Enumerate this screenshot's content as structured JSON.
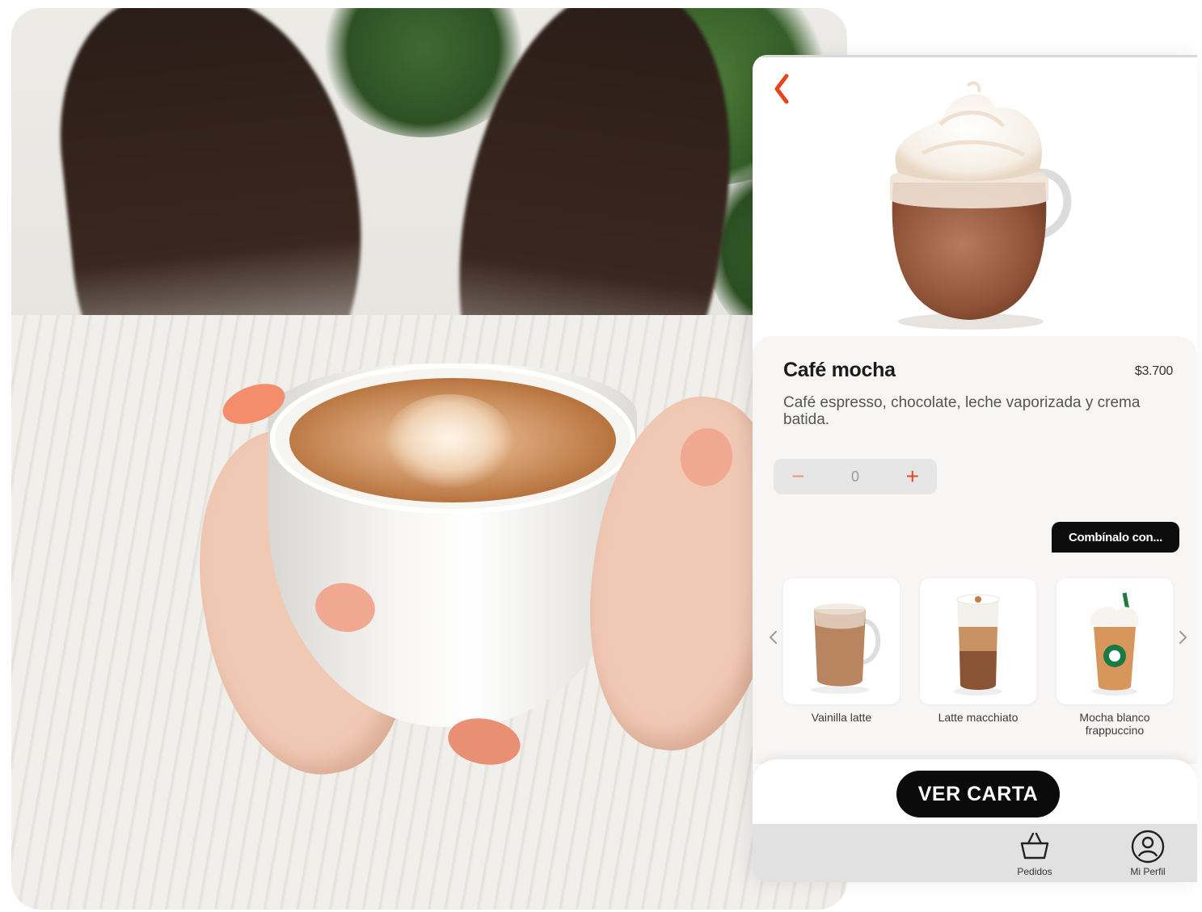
{
  "product": {
    "name": "Café mocha",
    "price": "$3.700",
    "description": "Café espresso, chocolate, leche vaporizada y crema batida."
  },
  "stepper": {
    "minus_label": "−",
    "quantity": "0",
    "plus_label": "+"
  },
  "combine": {
    "label": "Combínalo con..."
  },
  "suggestions": [
    {
      "name": "Vainilla latte"
    },
    {
      "name": "Latte macchiato"
    },
    {
      "name": "Mocha blanco frappuccino"
    }
  ],
  "cta": {
    "label": "VER CARTA"
  },
  "tabbar": {
    "items": [
      {
        "label": "Pedidos",
        "icon": "basket-icon"
      },
      {
        "label": "Mi Perfil",
        "icon": "profile-icon"
      }
    ]
  },
  "icons": {
    "back": "chevron-left-icon",
    "carousel_prev": "chevron-left-icon",
    "carousel_next": "chevron-right-icon"
  },
  "colors": {
    "accent": "#e8451f",
    "button_dark": "#0b0b0b",
    "panel_bg": "#f7f6f5",
    "tabbar_bg": "#e1e1e1"
  }
}
